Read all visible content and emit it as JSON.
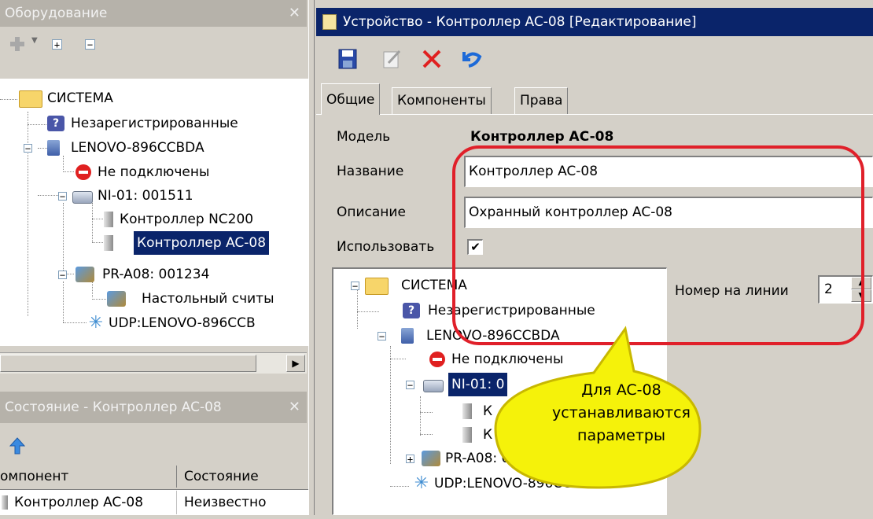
{
  "left_panel": {
    "title": "Оборудование",
    "toolbar": {
      "expand": "+",
      "collapse": "−"
    },
    "tree": {
      "system": "СИСТЕМА",
      "unregistered": "Незарегистрированные",
      "host": "LENOVO-896CCBDA",
      "not_connected": "Не подключены",
      "ni": "NI-01: 001511",
      "ctrl_nc": "Контроллер NC200",
      "ctrl_ac": "Контроллер AC-08",
      "pr": "PR-A08: 001234",
      "desk_reader": "Настольный считы",
      "udp": "UDP:LENOVO-896CCB"
    }
  },
  "status_panel": {
    "title": "Состояние - Контроллер AC-08",
    "columns": [
      "омпонент",
      "Состояние"
    ],
    "rows": [
      {
        "component": "Контроллер AC-08",
        "state": "Неизвестно"
      }
    ]
  },
  "device_window": {
    "title": "Устройство - Контроллер AC-08 [Редактирование]",
    "tabs": [
      "Общие",
      "Компоненты",
      "Права"
    ],
    "fields": {
      "model_label": "Модель",
      "model_value": "Контроллер AC-08",
      "name_label": "Название",
      "name_value": "Контроллер AC-08",
      "desc_label": "Описание",
      "desc_value": "Охранный контроллер AC-08",
      "use_label": "Использовать",
      "use_check": "✔",
      "line_label": "Номер на линии",
      "line_value": "2"
    },
    "tree": {
      "system": "СИСТЕМА",
      "unregistered": "Незарегистрированные",
      "host": "LENOVO-896CCBDA",
      "not_connected": "Не подключены",
      "ni": "NI-01: 0",
      "ctrl1": "К",
      "ctrl2": "К",
      "pr": "PR-A08: 0",
      "udp": "UDP:LENOVO-896CCB"
    }
  },
  "callout": {
    "text": "Для AC-08 устанавливаются параметры"
  },
  "colors": {
    "highlight": "#e0202a",
    "callout": "#f5f20a",
    "selection": "#0a246a",
    "titlebar": "#0a246a"
  }
}
